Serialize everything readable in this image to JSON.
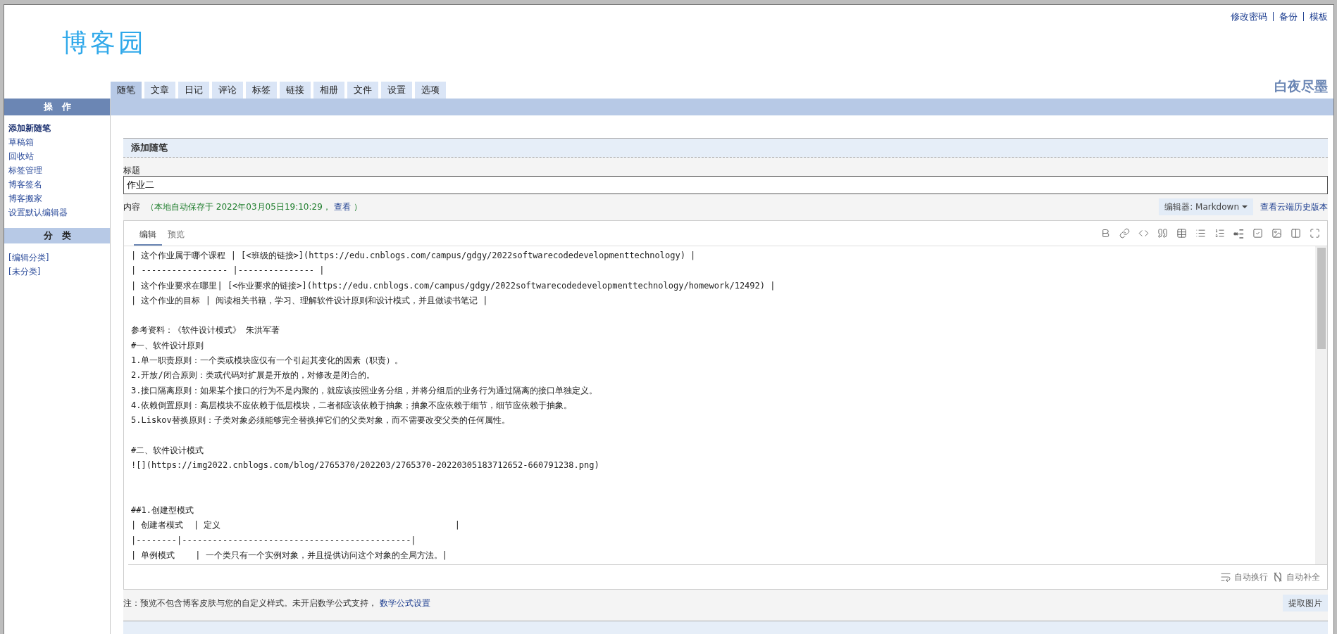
{
  "header": {
    "logo": "博客园",
    "top_links": [
      "修改密码",
      "备份",
      "模板"
    ],
    "blog_name": "白夜尽墨"
  },
  "nav_tabs": [
    {
      "label": "随笔",
      "selected": true
    },
    {
      "label": "文章",
      "selected": false
    },
    {
      "label": "日记",
      "selected": false
    },
    {
      "label": "评论",
      "selected": false
    },
    {
      "label": "标签",
      "selected": false
    },
    {
      "label": "链接",
      "selected": false
    },
    {
      "label": "相册",
      "selected": false
    },
    {
      "label": "文件",
      "selected": false
    },
    {
      "label": "设置",
      "selected": false
    },
    {
      "label": "选项",
      "selected": false
    }
  ],
  "sidebar": [
    {
      "title": "操　作",
      "kind": "primary",
      "items": [
        {
          "label": "添加新随笔",
          "selected": true
        },
        {
          "label": "草稿箱",
          "selected": false
        },
        {
          "label": "回收站",
          "selected": false
        },
        {
          "label": "标签管理",
          "selected": false
        },
        {
          "label": "博客签名",
          "selected": false
        },
        {
          "label": "博客搬家",
          "selected": false
        },
        {
          "label": "设置默认编辑器",
          "selected": false
        }
      ]
    },
    {
      "title": "分　类",
      "kind": "secondary",
      "items": [
        {
          "label": "[编辑分类]",
          "selected": false
        },
        {
          "label": "[未分类]",
          "selected": false
        }
      ]
    }
  ],
  "form": {
    "section_title": "添加随笔",
    "title_label": "标题",
    "title_value": "作业二",
    "content_label": "内容",
    "autosave": {
      "text": "（本地自动保存于 2022年03月05日19:10:29，",
      "link": "查看",
      "close": "）"
    },
    "editor_select": "编辑器: Markdown",
    "history_link": "查看云端历史版本"
  },
  "editor": {
    "tabs": [
      {
        "label": "编辑",
        "selected": true
      },
      {
        "label": "预览",
        "selected": false
      }
    ],
    "content": "| 这个作业属于哪个课程 | [<班级的链接>](https://edu.cnblogs.com/campus/gdgy/2022softwarecodedevelopmenttechnology) |\n| ----------------- |--------------- |\n| 这个作业要求在哪里| [<作业要求的链接>](https://edu.cnblogs.com/campus/gdgy/2022softwarecodedevelopmenttechnology/homework/12492) |\n| 这个作业的目标 | 阅读相关书籍，学习、理解软件设计原则和设计模式，并且做读书笔记 |\n\n参考资料：《软件设计模式》 朱洪军著\n#一、软件设计原则\n1.单一职责原则：一个类或模块应仅有一个引起其变化的因素（职责）。\n2.开放/闭合原则：类或代码对扩展是开放的，对修改是闭合的。\n3.接口隔离原则：如果某个接口的行为不是内聚的，就应该按照业务分组，并将分组后的业务行为通过隔离的接口单独定义。\n4.依赖倒置原则：高层模块不应依赖于低层模块，二者都应该依赖于抽象；抽象不应依赖于细节，细节应依赖于抽象。\n5.Liskov替换原则：子类对象必须能够完全替换掉它们的父类对象，而不需要改变父类的任何属性。\n\n#二、软件设计模式\n![](https://img2022.cnblogs.com/blog/2765370/202203/2765370-20220305183712652-660791238.png)\n\n\n##1.创建型模式\n| 创建者模式  | 定义                                              |\n|--------|---------------------------------------------|\n| 单例模式    | 一个类只有一个实例对象，并且提供访问这个对象的全局方法。|",
    "footer": [
      "自动换行",
      "自动补全"
    ]
  },
  "note": {
    "text": "注：预览不包含博客皮肤与您的自定义样式。未开启数学公式支持，",
    "link": "数学公式设置"
  },
  "extract_button": "提取图片"
}
